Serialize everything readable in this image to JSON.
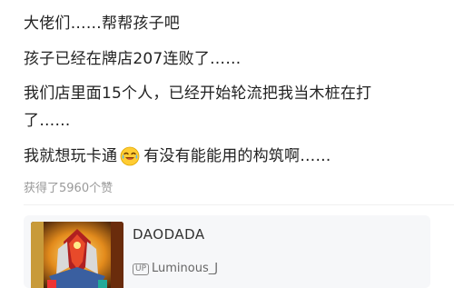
{
  "post": {
    "lines": [
      "大佬们……帮帮孩子吧",
      "孩子已经在牌店207连败了……",
      "我们店里面15个人，已经开始轮流把我当木桩在打",
      "了……"
    ],
    "last_line_before_emoji": "我就想玩卡通",
    "emoji_icon": "crying-laughing-emoji",
    "last_line_after_emoji": "有没有能能用的构筑啊……"
  },
  "likes": {
    "text": "获得了5960个赞"
  },
  "card": {
    "title": "DAODADA",
    "author_badge": "UP",
    "author_name": "Luminous_J",
    "cover_icon": "card-artwork-thumbnail"
  },
  "colors": {
    "text": "#222222",
    "muted": "#9a9a9a",
    "card_bg": "#f6f7f9"
  }
}
